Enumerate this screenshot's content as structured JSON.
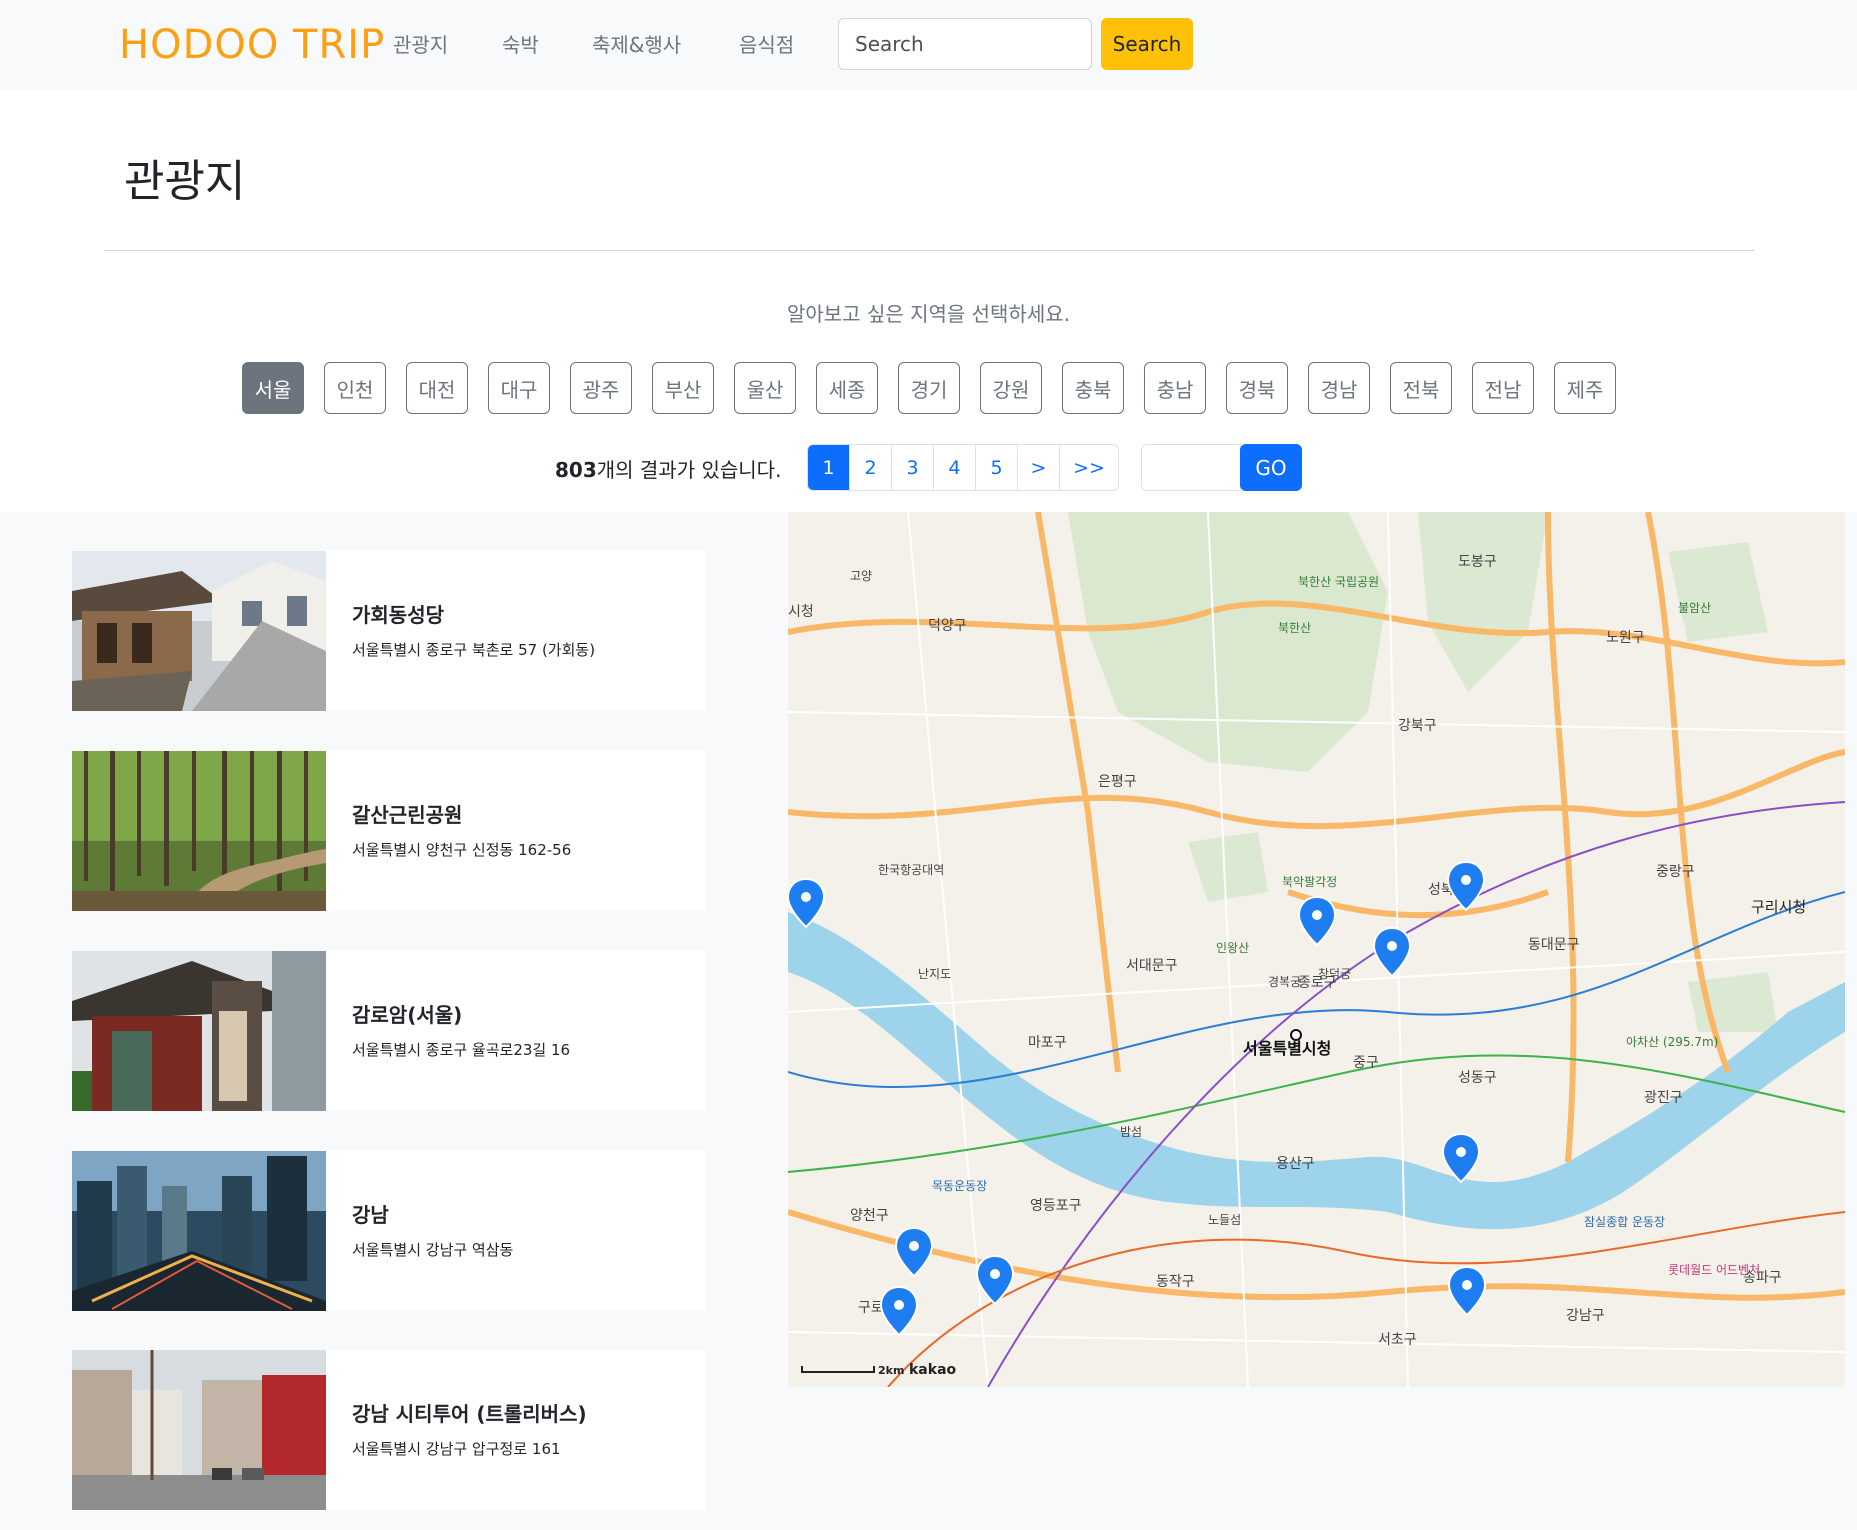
{
  "navbar": {
    "brand": "HODOO TRIP",
    "links": [
      "관광지",
      "숙박",
      "축제&행사",
      "음식점"
    ],
    "search_placeholder": "Search",
    "search_button": "Search"
  },
  "page": {
    "title": "관광지",
    "prompt": "알아보고 싶은 지역을 선택하세요."
  },
  "regions": {
    "items": [
      "서울",
      "인천",
      "대전",
      "대구",
      "광주",
      "부산",
      "울산",
      "세종",
      "경기",
      "강원",
      "충북",
      "충남",
      "경북",
      "경남",
      "전북",
      "전남",
      "제주"
    ],
    "selected": "서울"
  },
  "results": {
    "count": "803",
    "suffix": "개의 결과가 있습니다."
  },
  "pagination": {
    "pages": [
      "1",
      "2",
      "3",
      "4",
      "5"
    ],
    "current": "1",
    "next": ">",
    "last": ">>",
    "go_button": "GO"
  },
  "places": [
    {
      "name": "가회동성당",
      "address": "서울특별시 종로구 북촌로 57 (가회동)"
    },
    {
      "name": "갈산근린공원",
      "address": "서울특별시 양천구 신정동 162-56"
    },
    {
      "name": "감로암(서울)",
      "address": "서울특별시 종로구 율곡로23길 16"
    },
    {
      "name": "강남",
      "address": "서울특별시 강남구 역삼동"
    },
    {
      "name": "강남 시티투어 (트롤리버스)",
      "address": "서울특별시 강남구 압구정로 161"
    }
  ],
  "map": {
    "labels": {
      "center": "서울특별시청",
      "jongno": "종로구",
      "jung": "중구",
      "seodaemun": "서대문구",
      "mapo": "마포구",
      "yongsan": "용산구",
      "seongdong": "성동구",
      "gwangjin": "광진구",
      "dongdaemun": "동대문구",
      "gangbuk": "강북구",
      "dobong": "도봉구",
      "nowon": "노원구",
      "jungnang": "중랑구",
      "eunpyeong": "은평구",
      "deogyang": "덕양구",
      "yangcheon": "양천구",
      "guro": "구로",
      "yeongdeungpo": "영등포구",
      "dongjak": "동작구",
      "seocho": "서초구",
      "gangnam": "강남구",
      "songpa": "송파구",
      "bukhansan": "북한산",
      "bukhansan_park": "북한산 국립공원",
      "bugaksan": "북악팔각정",
      "inwangsan": "인왕산",
      "achasan": "아차산 (295.7m)",
      "guri": "구리시청",
      "goyang": "고양",
      "sijeong": "시청",
      "seongbuk": "성북",
      "bamseom": "밤섬",
      "nodeulseom": "노들섬",
      "nanjido": "난지도",
      "mokdong": "목동운동장",
      "jamsil": "잠실종합 운동장",
      "lotteworld": "롯데월드 어드벤처",
      "suraksan": "불암산",
      "hangang_airport": "한국항공대역",
      "gyeongbokgung": "경복궁",
      "changdeokgung": "창덕궁",
      "scale": "2km",
      "provider": "kakao"
    },
    "marker_color": "#1e7df0",
    "water_color": "#9ed3ec",
    "road_color": "#f8b868"
  }
}
